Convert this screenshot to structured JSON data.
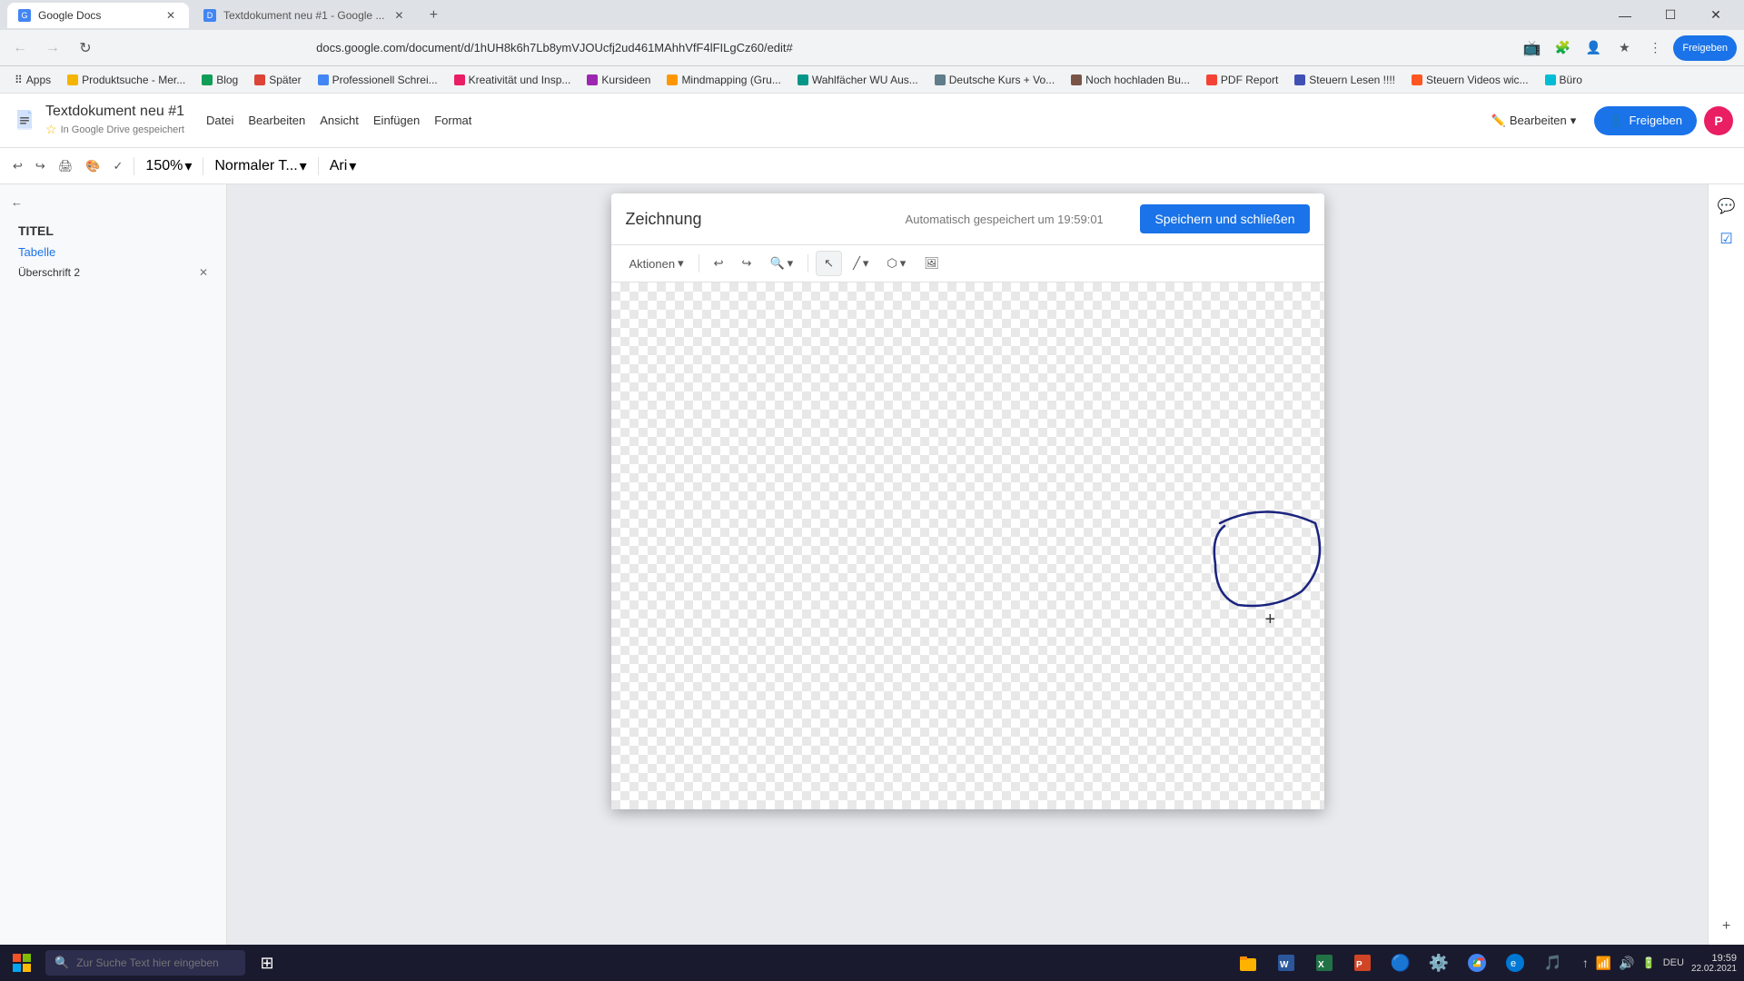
{
  "browser": {
    "tabs": [
      {
        "id": "tab1",
        "title": "Google Docs",
        "active": true,
        "favicon_color": "#4285f4"
      },
      {
        "id": "tab2",
        "title": "Textdokument neu #1 - Google ...",
        "active": false,
        "favicon_color": "#4285f4"
      }
    ],
    "address": "docs.google.com/document/d/1hUH8k6h7Lb8ymVJOUcfj2ud461MAhhVfF4lFILgCz60/edit#",
    "window_controls": {
      "minimize": "—",
      "maximize": "☐",
      "close": "✕"
    }
  },
  "bookmarks": [
    {
      "label": "Apps"
    },
    {
      "label": "Produktsuche - Mer..."
    },
    {
      "label": "Blog"
    },
    {
      "label": "Später"
    },
    {
      "label": "Professionell Schrei..."
    },
    {
      "label": "Kreativität und Insp..."
    },
    {
      "label": "Kursideen"
    },
    {
      "label": "Mindmapping (Gru..."
    },
    {
      "label": "Wahlfächer WU Aus..."
    },
    {
      "label": "Deutsche Kurs + Vo..."
    },
    {
      "label": "Noch hochladen Bu..."
    },
    {
      "label": "PDF Report"
    },
    {
      "label": "Steuern Lesen !!!!"
    },
    {
      "label": "Steuern Videos wic..."
    },
    {
      "label": "Büro"
    }
  ],
  "docs": {
    "title": "Textdokument neu #1",
    "menu_items": [
      "Datei",
      "Bearbeiten",
      "Ansicht",
      "Einfügen",
      "Format"
    ],
    "toolbar": {
      "undo": "↩",
      "redo": "↪",
      "print": "🖨",
      "paintformat": "🎨",
      "spellcheck": "✓",
      "zoom": "150%",
      "style": "Normaler T...",
      "font": "Ari"
    },
    "share_btn": "Freigeben",
    "edit_btn": "Bearbeiten",
    "autosave": "In Google Drive gespeichert"
  },
  "outline": {
    "back_icon": "←",
    "items": [
      {
        "label": "TITEL",
        "level": "title"
      },
      {
        "label": "Tabelle",
        "level": "h1"
      },
      {
        "label": "Überschrift 2",
        "level": "h2"
      }
    ]
  },
  "drawing": {
    "title": "Zeichnung",
    "autosave": "Automatisch gespeichert um 19:59:01",
    "save_btn": "Speichern und schließen",
    "toolbar": {
      "actions_label": "Aktionen",
      "undo": "↩",
      "redo": "↪",
      "zoom_label": "🔍",
      "select_icon": "↖",
      "line_icon": "╱",
      "shape_icon": "⬡",
      "image_icon": "🖼"
    }
  },
  "taskbar": {
    "search_placeholder": "Zur Suche Text hier eingeben",
    "time": "19:59",
    "date": "22.02.2021",
    "language": "DEU",
    "icons": [
      "⊞",
      "🔍",
      "📋",
      "📁",
      "W",
      "X",
      "P",
      "🎵",
      "⚙️",
      "🌐"
    ]
  },
  "colors": {
    "brand_blue": "#1a73e8",
    "docs_blue": "#4285f4",
    "save_btn_blue": "#1a73e8",
    "accent": "#1a73e8"
  }
}
